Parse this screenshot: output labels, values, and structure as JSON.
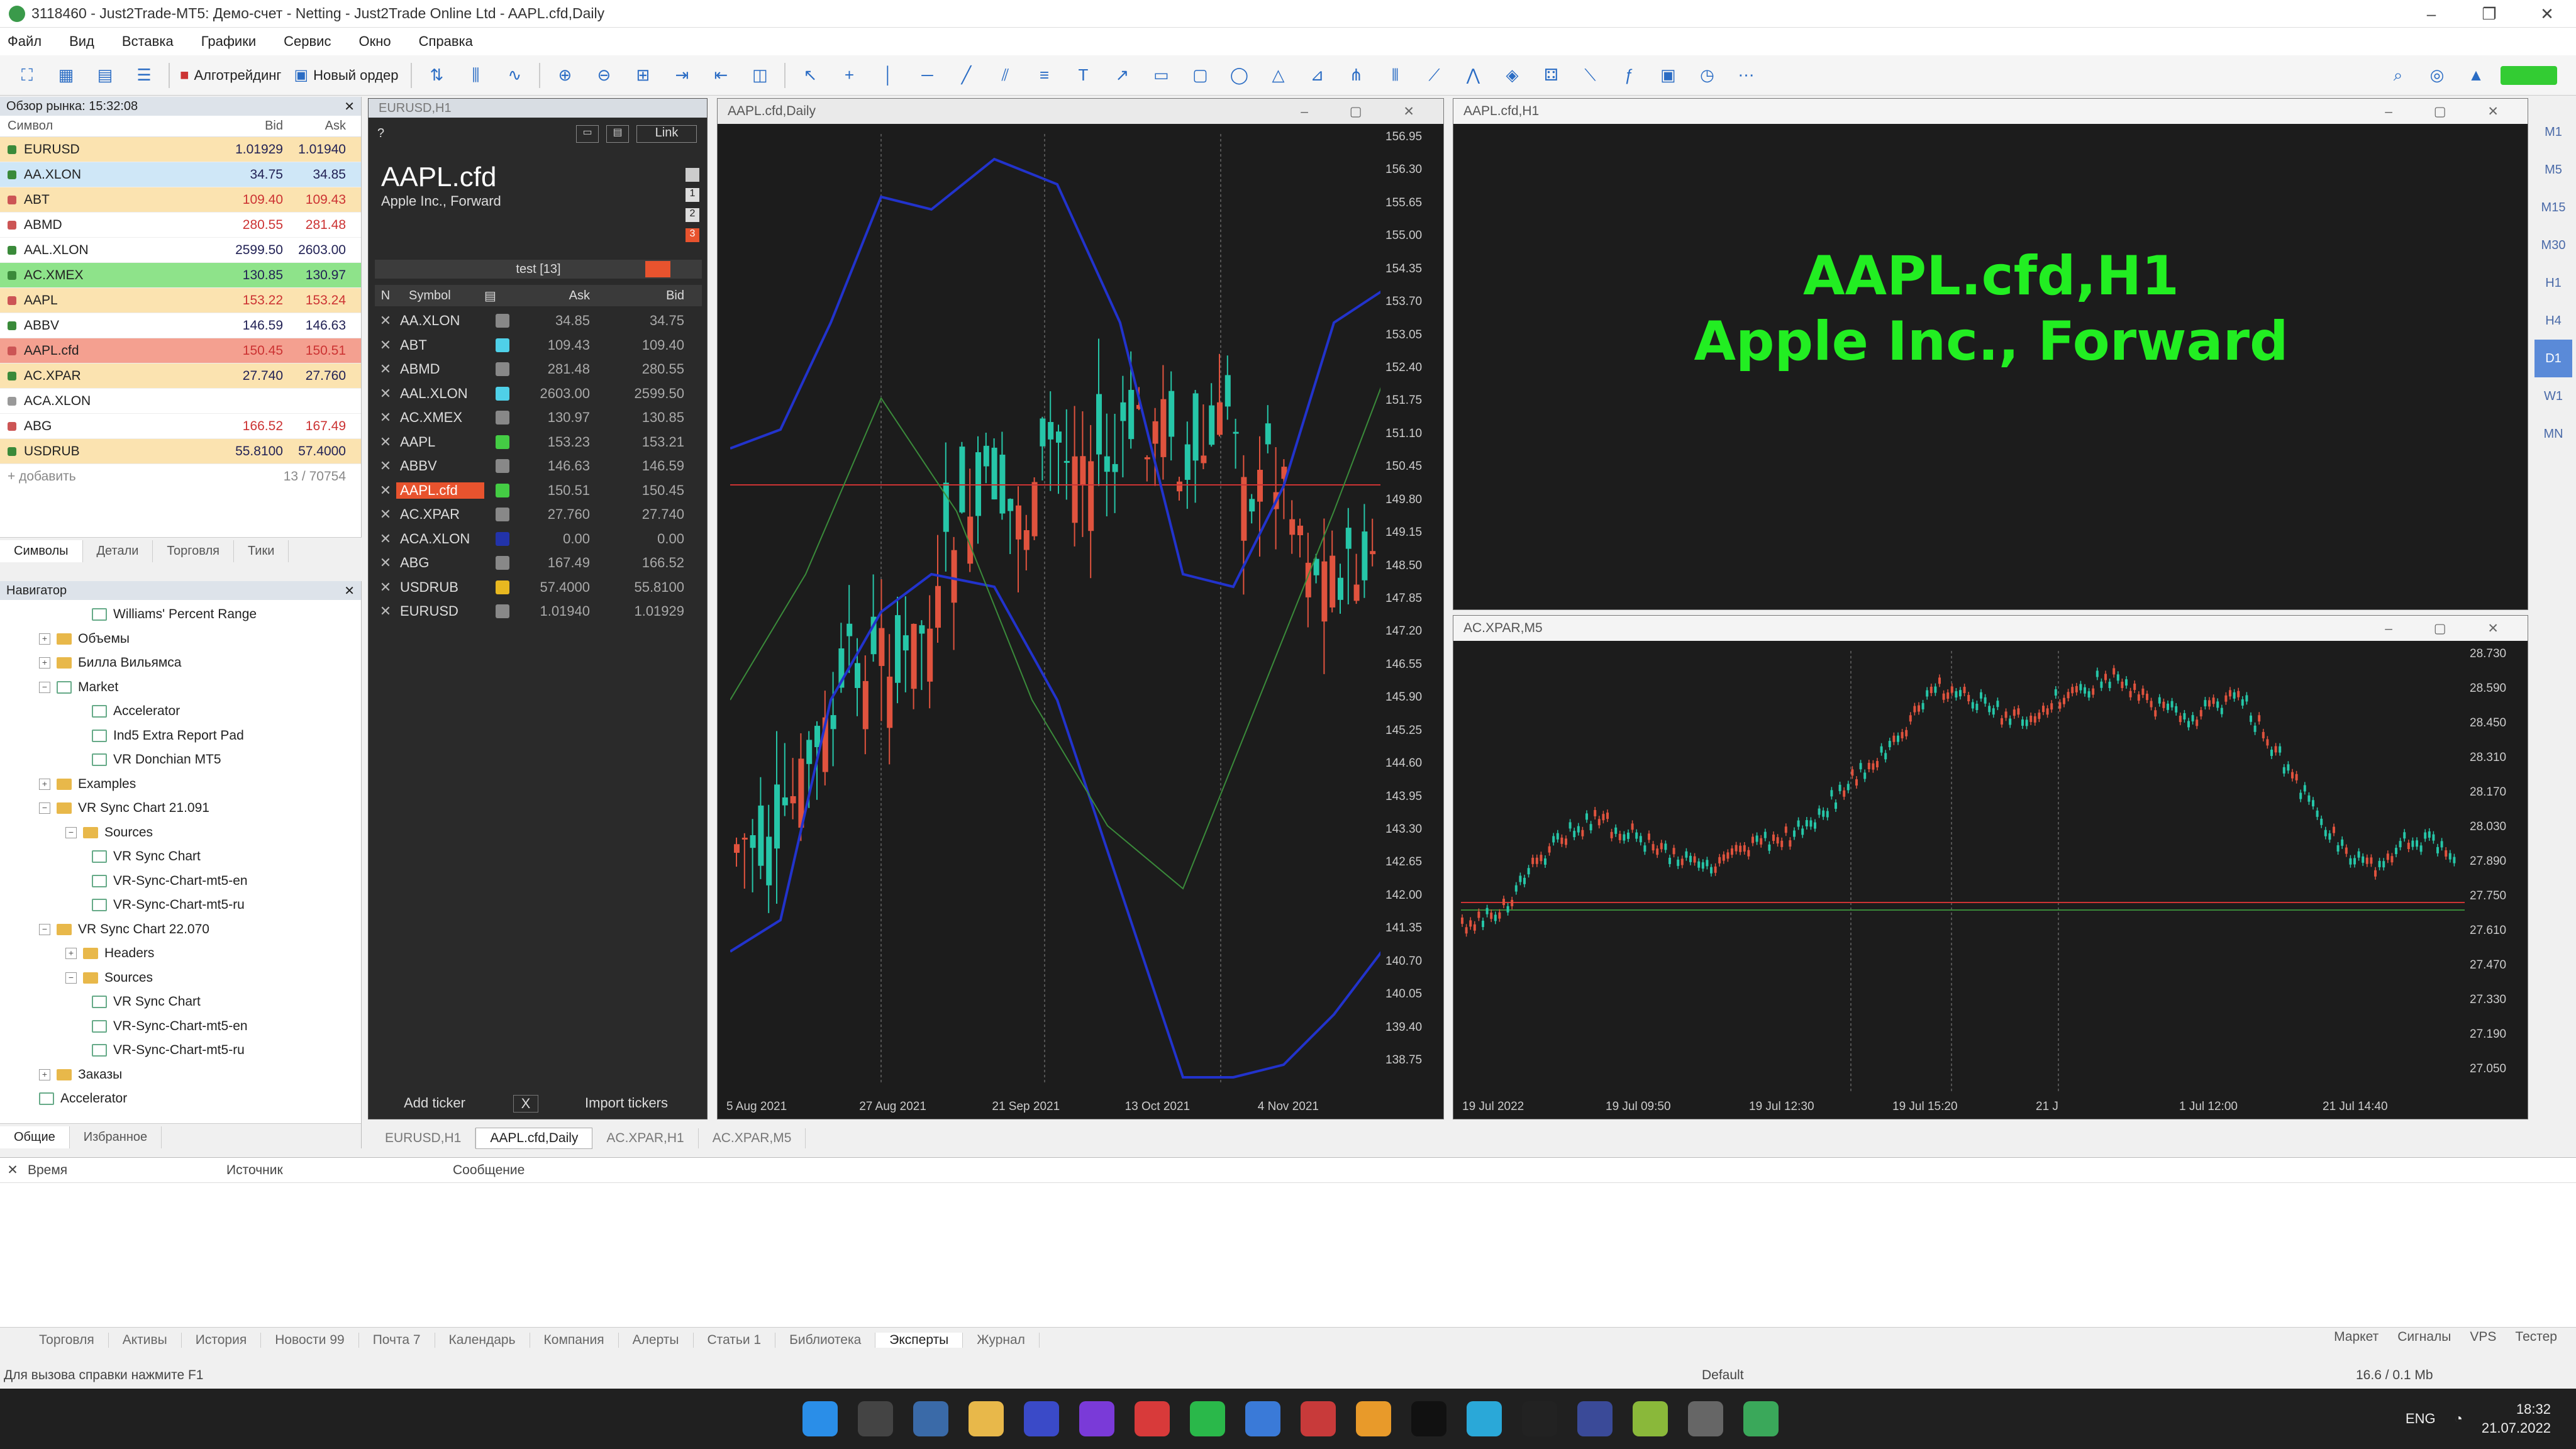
{
  "window": {
    "title": "3118460 - Just2Trade-MT5: Демо-счет - Netting - Just2Trade Online Ltd - AAPL.cfd,Daily"
  },
  "menu": [
    "Файл",
    "Вид",
    "Вставка",
    "Графики",
    "Сервис",
    "Окно",
    "Справка"
  ],
  "toolbar": {
    "algo_label": "Алготрейдинг",
    "order_label": "Новый ордер"
  },
  "market_watch": {
    "title": "Обзор рынка: 15:32:08",
    "col_symbol": "Символ",
    "col_bid": "Bid",
    "col_ask": "Ask",
    "rows": [
      {
        "sym": "EURUSD",
        "bid": "1.01929",
        "ask": "1.01940",
        "bg": "#fbe3b0",
        "mk": "#3a8a3a"
      },
      {
        "sym": "AA.XLON",
        "bid": "34.75",
        "ask": "34.85",
        "bg": "#cfe7f7",
        "mk": "#3a8a3a"
      },
      {
        "sym": "ABT",
        "bid": "109.40",
        "ask": "109.43",
        "bg": "#fbe3b0",
        "mk": "#c55"
      },
      {
        "sym": "ABMD",
        "bid": "280.55",
        "ask": "281.48",
        "bg": "#fff",
        "mk": "#c55"
      },
      {
        "sym": "AAL.XLON",
        "bid": "2599.50",
        "ask": "2603.00",
        "bg": "#fff",
        "mk": "#3a8a3a"
      },
      {
        "sym": "AC.XMEX",
        "bid": "130.85",
        "ask": "130.97",
        "bg": "#8ee38a",
        "mk": "#3a8a3a"
      },
      {
        "sym": "AAPL",
        "bid": "153.22",
        "ask": "153.24",
        "bg": "#fbe3b0",
        "mk": "#c55"
      },
      {
        "sym": "ABBV",
        "bid": "146.59",
        "ask": "146.63",
        "bg": "#fff",
        "mk": "#3a8a3a"
      },
      {
        "sym": "AAPL.cfd",
        "bid": "150.45",
        "ask": "150.51",
        "bg": "#f4a090",
        "mk": "#c55"
      },
      {
        "sym": "AC.XPAR",
        "bid": "27.740",
        "ask": "27.760",
        "bg": "#fbe3b0",
        "mk": "#3a8a3a"
      },
      {
        "sym": "ACA.XLON",
        "bid": "",
        "ask": "",
        "bg": "#fff",
        "mk": "#999"
      },
      {
        "sym": "ABG",
        "bid": "166.52",
        "ask": "167.49",
        "bg": "#fff",
        "mk": "#c55"
      },
      {
        "sym": "USDRUB",
        "bid": "55.8100",
        "ask": "57.4000",
        "bg": "#fbe3b0",
        "mk": "#3a8a3a"
      }
    ],
    "add_label": "+ добавить",
    "count": "13 / 70754",
    "tabs": [
      "Символы",
      "Детали",
      "Торговля",
      "Тики"
    ]
  },
  "navigator": {
    "title": "Навигатор",
    "items": [
      {
        "label": "Williams' Percent Range",
        "lvl": 3,
        "type": "ind",
        "exp": ""
      },
      {
        "label": "Объемы",
        "lvl": 1,
        "type": "folder",
        "exp": "+"
      },
      {
        "label": "Билла Вильямса",
        "lvl": 1,
        "type": "folder",
        "exp": "+"
      },
      {
        "label": "Market",
        "lvl": 1,
        "type": "ind",
        "exp": "−"
      },
      {
        "label": "Accelerator",
        "lvl": 3,
        "type": "ind",
        "exp": ""
      },
      {
        "label": "Ind5 Extra Report Pad",
        "lvl": 3,
        "type": "ind",
        "exp": ""
      },
      {
        "label": "VR Donchian MT5",
        "lvl": 3,
        "type": "ind",
        "exp": ""
      },
      {
        "label": "Examples",
        "lvl": 1,
        "type": "folder",
        "exp": "+"
      },
      {
        "label": "VR Sync Chart 21.091",
        "lvl": 1,
        "type": "folder",
        "exp": "−"
      },
      {
        "label": "Sources",
        "lvl": 2,
        "type": "folder",
        "exp": "−"
      },
      {
        "label": "VR Sync Chart",
        "lvl": 3,
        "type": "ind",
        "exp": ""
      },
      {
        "label": "VR-Sync-Chart-mt5-en",
        "lvl": 3,
        "type": "ind",
        "exp": ""
      },
      {
        "label": "VR-Sync-Chart-mt5-ru",
        "lvl": 3,
        "type": "ind",
        "exp": ""
      },
      {
        "label": "VR Sync Chart 22.070",
        "lvl": 1,
        "type": "folder",
        "exp": "−"
      },
      {
        "label": "Headers",
        "lvl": 2,
        "type": "folder",
        "exp": "+"
      },
      {
        "label": "Sources",
        "lvl": 2,
        "type": "folder",
        "exp": "−"
      },
      {
        "label": "VR Sync Chart",
        "lvl": 3,
        "type": "ind",
        "exp": ""
      },
      {
        "label": "VR-Sync-Chart-mt5-en",
        "lvl": 3,
        "type": "ind",
        "exp": ""
      },
      {
        "label": "VR-Sync-Chart-mt5-ru",
        "lvl": 3,
        "type": "ind",
        "exp": ""
      },
      {
        "label": "Заказы",
        "lvl": 1,
        "type": "folder",
        "exp": "+"
      },
      {
        "label": "Accelerator",
        "lvl": 1,
        "type": "ind",
        "exp": ""
      }
    ],
    "tabs": [
      "Общие",
      "Избранное"
    ]
  },
  "ticker_panel": {
    "window_title": "EURUSD,H1",
    "symbol": "AAPL.cfd",
    "desc": "Apple Inc., Forward",
    "link": "Link",
    "list_name": "test [13]",
    "col_n": "N",
    "col_symbol": "Symbol",
    "col_ask": "Ask",
    "col_bid": "Bid",
    "rows": [
      {
        "s": "AA.XLON",
        "a": "34.85",
        "b": "34.75",
        "c": "#888"
      },
      {
        "s": "ABT",
        "a": "109.43",
        "b": "109.40",
        "c": "#4fd0e8"
      },
      {
        "s": "ABMD",
        "a": "281.48",
        "b": "280.55",
        "c": "#888"
      },
      {
        "s": "AAL.XLON",
        "a": "2603.00",
        "b": "2599.50",
        "c": "#4fd0e8"
      },
      {
        "s": "AC.XMEX",
        "a": "130.97",
        "b": "130.85",
        "c": "#888"
      },
      {
        "s": "AAPL",
        "a": "153.23",
        "b": "153.21",
        "c": "#4c4"
      },
      {
        "s": "ABBV",
        "a": "146.63",
        "b": "146.59",
        "c": "#888"
      },
      {
        "s": "AAPL.cfd",
        "a": "150.51",
        "b": "150.45",
        "c": "#4c4"
      },
      {
        "s": "AC.XPAR",
        "a": "27.760",
        "b": "27.740",
        "c": "#888"
      },
      {
        "s": "ACA.XLON",
        "a": "0.00",
        "b": "0.00",
        "c": "#2233aa"
      },
      {
        "s": "ABG",
        "a": "167.49",
        "b": "166.52",
        "c": "#888"
      },
      {
        "s": "USDRUB",
        "a": "57.4000",
        "b": "55.8100",
        "c": "#e8b820"
      },
      {
        "s": "EURUSD",
        "a": "1.01940",
        "b": "1.01929",
        "c": "#888"
      }
    ],
    "add_btn": "Add ticker",
    "x_btn": "X",
    "import_btn": "Import tickers"
  },
  "chart_daily": {
    "title": "AAPL.cfd,Daily",
    "prices": [
      "156.95",
      "156.30",
      "155.65",
      "155.00",
      "154.35",
      "153.70",
      "153.05",
      "152.40",
      "151.75",
      "151.10",
      "150.45",
      "149.80",
      "149.15",
      "148.50",
      "147.85",
      "147.20",
      "146.55",
      "145.90",
      "145.25",
      "144.60",
      "143.95",
      "143.30",
      "142.65",
      "142.00",
      "141.35",
      "140.70",
      "140.05",
      "139.40",
      "138.75"
    ],
    "dates": [
      "5 Aug 2021",
      "27 Aug 2021",
      "21 Sep 2021",
      "13 Oct 2021",
      "4 Nov 2021"
    ]
  },
  "chart_h1": {
    "title": "AAPL.cfd,H1",
    "big1": "AAPL.cfd,H1",
    "big2": "Apple Inc., Forward"
  },
  "chart_m5": {
    "title": "AC.XPAR,M5",
    "prices": [
      "28.730",
      "28.590",
      "28.450",
      "28.310",
      "28.170",
      "28.030",
      "27.890",
      "27.750",
      "27.610",
      "27.470",
      "27.330",
      "27.190",
      "27.050"
    ],
    "dates": [
      "19 Jul 2022",
      "19 Jul 09:50",
      "19 Jul 12:30",
      "19 Jul 15:20",
      "21 J",
      "1 Jul 12:00",
      "21 Jul 14:40"
    ]
  },
  "timeframes": [
    "M1",
    "M5",
    "M15",
    "M30",
    "H1",
    "H4",
    "D1",
    "W1",
    "MN"
  ],
  "chart_tabs": [
    "EURUSD,H1",
    "AAPL.cfd,Daily",
    "AC.XPAR,H1",
    "AC.XPAR,M5"
  ],
  "journal": {
    "col_time": "Время",
    "col_source": "Источник",
    "col_message": "Сообщение"
  },
  "bottom_tabs": [
    "Торговля",
    "Активы",
    "История",
    "Новости 99",
    "Почта 7",
    "Календарь",
    "Компания",
    "Алерты",
    "Статьи 1",
    "Библиотека",
    "Эксперты",
    "Журнал"
  ],
  "bottom_right": [
    "Маркет",
    "Сигналы",
    "VPS",
    "Тестер"
  ],
  "status": {
    "help": "Для вызова справки нажмите F1",
    "profile": "Default",
    "net": "16.6 / 0.1 Mb"
  },
  "taskbar": {
    "lang": "ENG",
    "time": "18:32",
    "date": "21.07.2022"
  },
  "colors": {
    "up": "#26c6a8",
    "down": "#e0533e",
    "accent": "#22ee22"
  }
}
